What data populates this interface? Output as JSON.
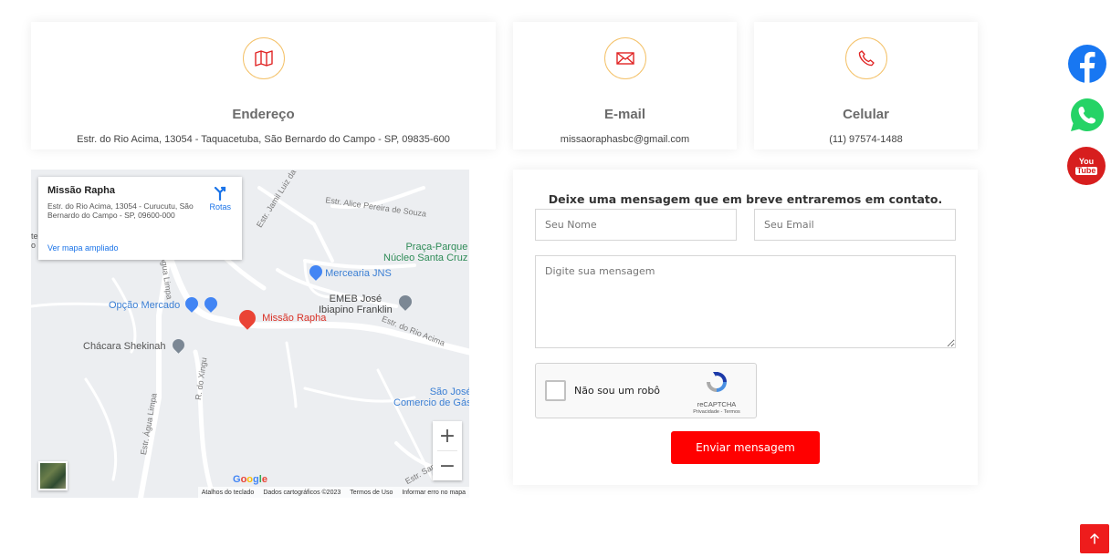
{
  "info_cards": {
    "address": {
      "icon": "map-icon",
      "title": "Endereço",
      "text": "Estr. do Rio Acima, 13054 - Taquacetuba, São Bernardo do Campo - SP, 09835-600"
    },
    "email": {
      "icon": "envelope-icon",
      "title": "E-mail",
      "text": "missaoraphasbc@gmail.com"
    },
    "phone": {
      "icon": "phone-icon",
      "title": "Celular",
      "text": "(11) 97574-1488"
    }
  },
  "map": {
    "popup": {
      "title": "Missão Rapha",
      "address": "Estr. do Rio Acima, 13054 - Curucutu, São Bernardo do Campo - SP, 09600-000",
      "directions_label": "Rotas",
      "larger_map_link": "Ver mapa ampliado"
    },
    "labels": {
      "marker": "Missão Rapha",
      "mercearia": "Mercearia JNS",
      "opcao_mercado": "Opção Mercado",
      "chacara": "Chácara Shekinah",
      "emeb_line1": "EMEB José",
      "emeb_line2": "Ibiapino Franklin",
      "praca_line1": "Praça-Parque",
      "praca_line2": "Núcleo Santa Cruz",
      "sao_jose_line1": "São José",
      "sao_jose_line2": "Comercio de Gás",
      "road_jamil": "Estr. Jamil Luiz da Cruz",
      "road_alice": "Estr. Alice Pereira de Souza",
      "road_rio_acima": "Estr. do Rio Acima",
      "road_agua_limpa": "Estr. Água Limpa",
      "road_xingu": "R. do Xingu",
      "road_limpa": "Água Limpa",
      "road_sant": "Estr. Sant",
      "edge_left_1": "te",
      "edge_left_2": "o S"
    },
    "zoom_in": "+",
    "zoom_out": "−",
    "google": "Google",
    "footer": {
      "shortcuts": "Atalhos do teclado",
      "data": "Dados cartográficos ©2023",
      "terms": "Termos de Uso",
      "report": "Informar erro no mapa"
    }
  },
  "form": {
    "heading": "Deixe uma mensagem que em breve entraremos em contato.",
    "name_placeholder": "Seu Nome",
    "email_placeholder": "Seu Email",
    "message_placeholder": "Digite sua mensagem",
    "captcha_label": "Não sou um robô",
    "captcha_brand": "reCAPTCHA",
    "captcha_links": "Privacidade - Termos",
    "submit_label": "Enviar mensagem"
  },
  "social": {
    "facebook": {
      "icon": "facebook-icon",
      "color": "#1877f2"
    },
    "whatsapp": {
      "icon": "whatsapp-icon",
      "color": "#25d366"
    },
    "youtube": {
      "icon": "youtube-icon",
      "color": "#d71e1e",
      "text_top": "You",
      "text_bottom": "Tube"
    }
  },
  "colors": {
    "accent": "#ff0000",
    "icon_red": "#e02424",
    "icon_border": "#f4c26a"
  }
}
